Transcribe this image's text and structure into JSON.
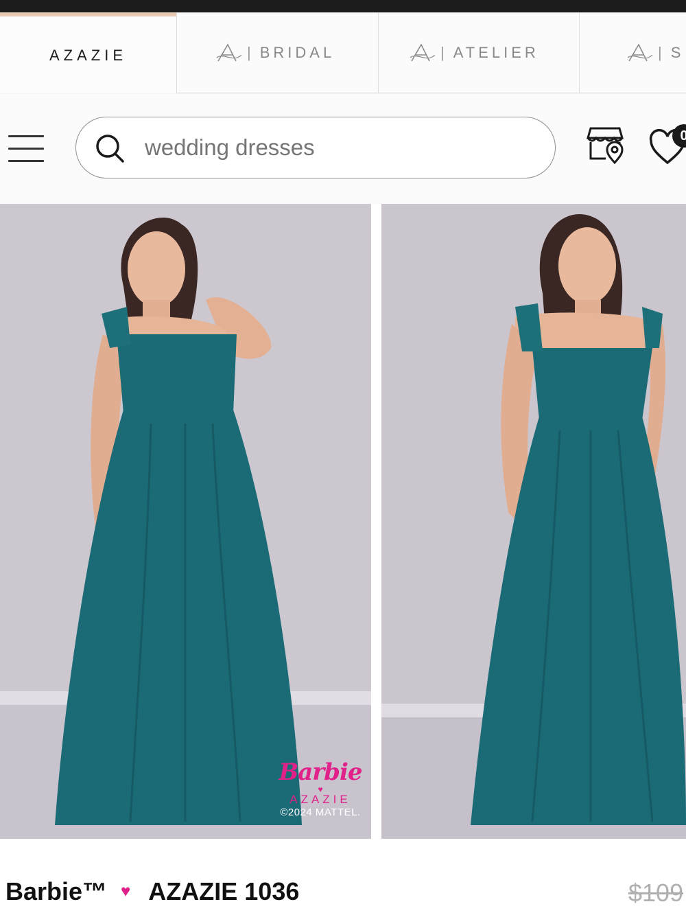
{
  "brand_tabs": [
    {
      "label": "AZAZIE",
      "active": true
    },
    {
      "label": "BRIDAL",
      "prefix": "|"
    },
    {
      "label": "ATELIER",
      "prefix": "|"
    },
    {
      "label": "S",
      "prefix": "|"
    }
  ],
  "search": {
    "placeholder": "wedding dresses",
    "value": ""
  },
  "header_icons": [
    "menu-icon",
    "search-icon",
    "store-location-icon",
    "heart-icon"
  ],
  "wishlist": {
    "badge": "0"
  },
  "gallery": {
    "images": [
      {
        "alt": "Model in teal chiffon A-line gown, hand at neck"
      },
      {
        "alt": "Model in teal chiffon A-line gown, front view"
      }
    ],
    "watermark": {
      "script": "Barbie",
      "heart": "♥",
      "brand": "AZAZIE",
      "copyright": "©2024 MATTEL."
    }
  },
  "product": {
    "name_prefix": "Barbie",
    "tm": "™",
    "heart": "♥",
    "name": "AZAZIE 1036",
    "price_original": "$109"
  },
  "colors": {
    "accent": "#e8c9b4",
    "barbie_pink": "#e0218a",
    "dress_teal": "#1b6b76",
    "backdrop": "#ccc7cf"
  }
}
